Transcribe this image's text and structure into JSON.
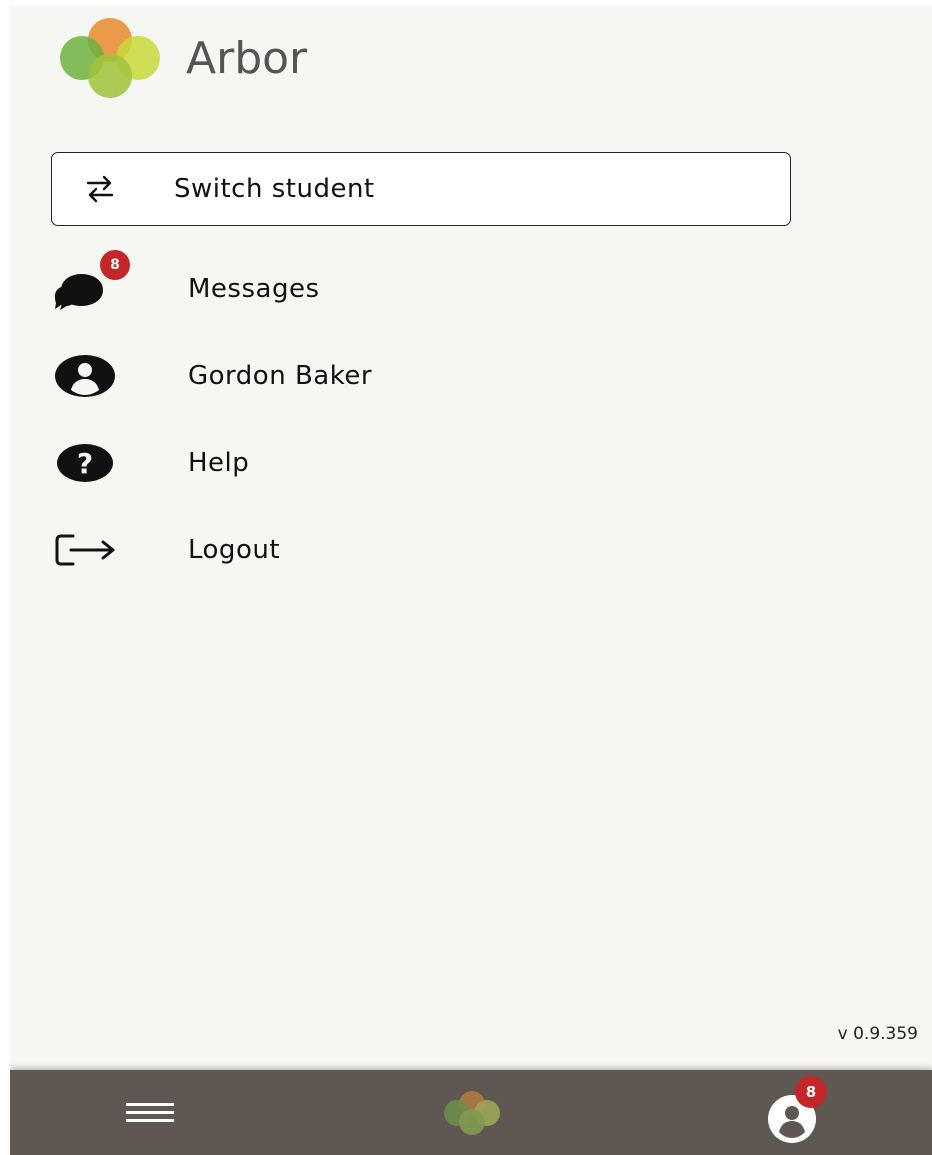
{
  "app": {
    "logo_text": "Arbor"
  },
  "switch_student": {
    "label": "Switch student",
    "icon": "swap-arrows-icon"
  },
  "menu": {
    "items": [
      {
        "label": "Messages",
        "icon": "chat-bubbles-icon",
        "badge": "8"
      },
      {
        "label": "Gordon Baker",
        "icon": "user-circle-icon"
      },
      {
        "label": "Help",
        "icon": "help-circle-icon"
      },
      {
        "label": "Logout",
        "icon": "logout-icon"
      }
    ]
  },
  "footer": {
    "version": "v 0.9.359"
  },
  "bottom_nav": {
    "items": [
      {
        "icon": "hamburger-menu-icon"
      },
      {
        "icon": "arbor-home-icon"
      },
      {
        "icon": "user-avatar-icon",
        "badge": "8"
      }
    ]
  },
  "colors": {
    "background": "#f6f6f3",
    "bottom_bar": "#5f5752",
    "badge": "#c4262a",
    "logo_orange": "#e88a2a",
    "logo_green": "#6db33f",
    "logo_lime": "#c8d93a"
  }
}
